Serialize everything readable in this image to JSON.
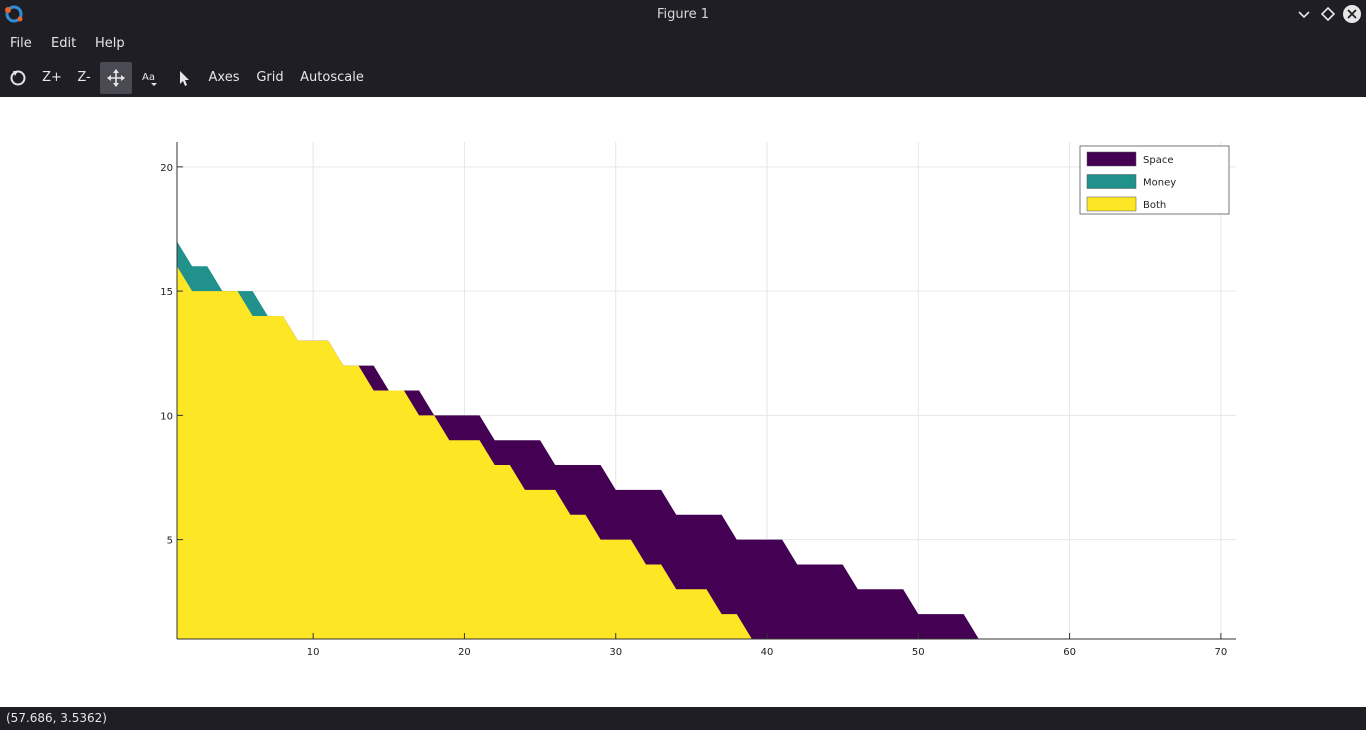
{
  "window": {
    "title": "Figure 1"
  },
  "menu": {
    "items": [
      "File",
      "Edit",
      "Help"
    ]
  },
  "toolbar": {
    "zoom_in": "Z+",
    "zoom_out": "Z-",
    "axes": "Axes",
    "grid": "Grid",
    "autoscale": "Autoscale"
  },
  "status": {
    "coords": "(57.686, 3.5362)"
  },
  "colors": {
    "space": "#440154",
    "money": "#21918c",
    "both": "#fde725",
    "chrome": "#1f1e24"
  },
  "chart_data": {
    "type": "area",
    "title": "",
    "xlabel": "",
    "ylabel": "",
    "xlim": [
      1,
      71
    ],
    "ylim": [
      1,
      21
    ],
    "xticks": [
      10,
      20,
      30,
      40,
      50,
      60,
      70
    ],
    "yticks": [
      5,
      10,
      15,
      20
    ],
    "grid": true,
    "legend_position": "top-right",
    "series": [
      {
        "name": "Space",
        "color": "#440154",
        "points": [
          [
            1,
            16
          ],
          [
            2,
            15
          ],
          [
            5,
            15
          ],
          [
            6,
            14
          ],
          [
            8,
            14
          ],
          [
            9,
            13
          ],
          [
            11,
            13
          ],
          [
            12,
            12
          ],
          [
            14,
            12
          ],
          [
            15,
            11
          ],
          [
            17,
            11
          ],
          [
            18,
            10
          ],
          [
            21,
            10
          ],
          [
            22,
            9
          ],
          [
            25,
            9
          ],
          [
            26,
            8
          ],
          [
            29,
            8
          ],
          [
            30,
            7
          ],
          [
            33,
            7
          ],
          [
            34,
            6
          ],
          [
            37,
            6
          ],
          [
            38,
            5
          ],
          [
            41,
            5
          ],
          [
            42,
            4
          ],
          [
            45,
            4
          ],
          [
            46,
            3
          ],
          [
            49,
            3
          ],
          [
            50,
            2
          ],
          [
            53,
            2
          ],
          [
            54,
            1
          ],
          [
            58,
            1
          ]
        ]
      },
      {
        "name": "Money",
        "color": "#21918c",
        "points": [
          [
            1,
            17
          ],
          [
            2,
            16
          ],
          [
            3,
            16
          ],
          [
            4,
            15
          ],
          [
            5,
            15
          ],
          [
            6,
            15
          ],
          [
            7,
            14
          ]
        ]
      },
      {
        "name": "Both",
        "color": "#fde725",
        "points": [
          [
            1,
            16
          ],
          [
            2,
            15
          ],
          [
            5,
            15
          ],
          [
            6,
            14
          ],
          [
            8,
            14
          ],
          [
            9,
            13
          ],
          [
            11,
            13
          ],
          [
            12,
            12
          ],
          [
            13,
            12
          ],
          [
            14,
            11
          ],
          [
            16,
            11
          ],
          [
            17,
            10
          ],
          [
            18,
            10
          ],
          [
            19,
            9
          ],
          [
            21,
            9
          ],
          [
            22,
            8
          ],
          [
            23,
            8
          ],
          [
            24,
            7
          ],
          [
            26,
            7
          ],
          [
            27,
            6
          ],
          [
            28,
            6
          ],
          [
            29,
            5
          ],
          [
            31,
            5
          ],
          [
            32,
            4
          ],
          [
            33,
            4
          ],
          [
            34,
            3
          ],
          [
            36,
            3
          ],
          [
            37,
            2
          ],
          [
            38,
            2
          ],
          [
            39,
            1
          ]
        ]
      }
    ]
  }
}
